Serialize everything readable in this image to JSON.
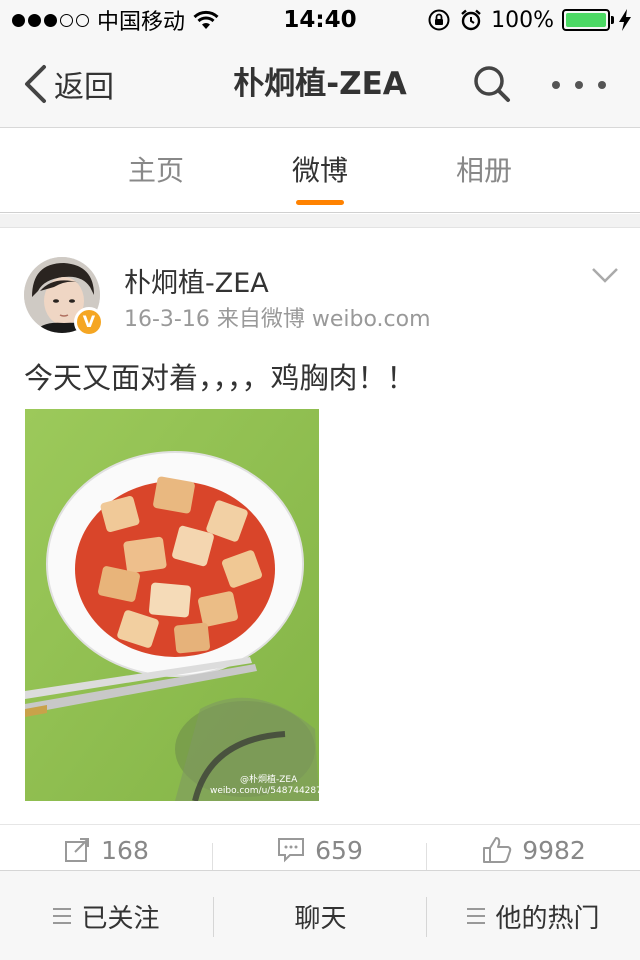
{
  "status_bar": {
    "signal_dots_filled": 3,
    "signal_dots_total": 5,
    "carrier": "中国移动",
    "time": "14:40",
    "battery_percent": "100%",
    "battery_level": 1.0,
    "battery_color": "#4cd964"
  },
  "nav": {
    "back_label": "返回",
    "title": "朴炯植-ZEA",
    "icons": [
      "chevron-left-icon",
      "search-icon",
      "more-icon"
    ]
  },
  "tabs": [
    {
      "label": "主页",
      "active": false
    },
    {
      "label": "微博",
      "active": true
    },
    {
      "label": "相册",
      "active": false
    }
  ],
  "accent_color": "#ff8200",
  "post": {
    "author": "朴炯植-ZEA",
    "meta": "16-3-16  来自微博 weibo.com",
    "verified": "V",
    "text": "今天又面对着，，，，鸡胸肉！！",
    "image_alt": "Plate of chicken breast in red sauce on a green cutting board",
    "watermark_line1": "@朴炯植-ZEA",
    "watermark_line2": "weibo.com/u/5487442871"
  },
  "actions": [
    {
      "icon": "share-icon",
      "count": "168"
    },
    {
      "icon": "comment-icon",
      "count": "659"
    },
    {
      "icon": "like-icon",
      "count": "9982"
    }
  ],
  "bottom_bar": [
    {
      "label": "已关注",
      "icon": "menu-icon"
    },
    {
      "label": "聊天",
      "icon": ""
    },
    {
      "label": "他的热门",
      "icon": "menu-icon"
    }
  ]
}
